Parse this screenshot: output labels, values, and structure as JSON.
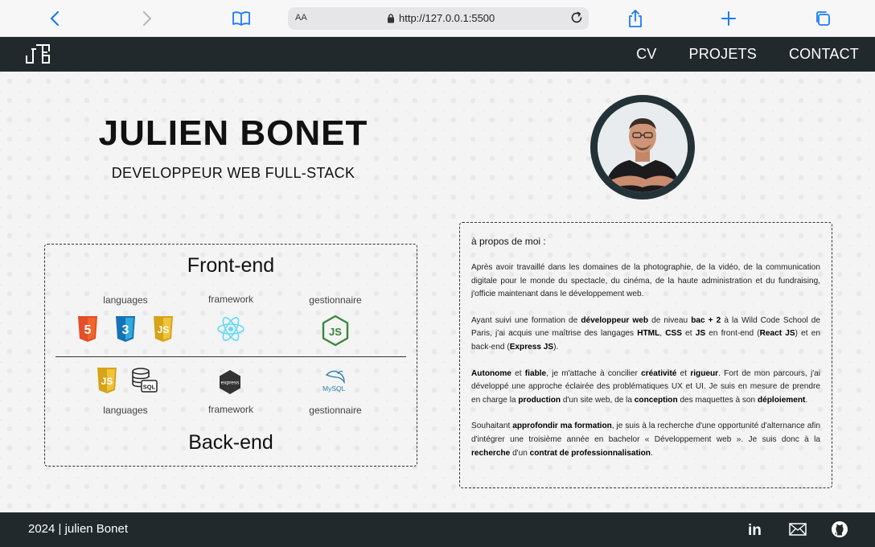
{
  "browser": {
    "url_text_size": "AA",
    "url": "http://127.0.0.1:5500"
  },
  "header": {
    "logo_text": "JB",
    "nav": [
      {
        "label": "CV"
      },
      {
        "label": "PROJETS"
      },
      {
        "label": "CONTACT"
      }
    ]
  },
  "hero": {
    "name": "JULIEN BONET",
    "title": "DEVELOPPEUR WEB FULL-STACK"
  },
  "skills": {
    "front_heading": "Front-end",
    "back_heading": "Back-end",
    "front_labels": [
      "languages",
      "framework",
      "gestionnaire"
    ],
    "back_labels": [
      "languages",
      "framework",
      "gestionnaire"
    ],
    "icons": {
      "html5": "5",
      "css3": "3",
      "js": "JS",
      "nodejs": "JS",
      "sql": "SQL",
      "express": "express",
      "mysql": "MySQL"
    }
  },
  "about": {
    "heading": "à propos de moi :",
    "p1": "Après avoir travaillé dans les domaines de la photographie, de la vidéo, de la communication digitale pour le monde du spectacle, du cinéma, de la haute administration et du fundraising, j'officie maintenant dans le développement web.",
    "p2": {
      "t1": "Ayant suivi une formation de ",
      "b1": "développeur web",
      "t2": " de niveau ",
      "b2": "bac + 2",
      "t3": " à la Wild Code School de Paris, j'ai acquis une maîtrise des langages ",
      "b3": "HTML",
      "t4": ", ",
      "b4": "CSS",
      "t5": " et ",
      "b5": "JS",
      "t6": " en front-end (",
      "b6": "React JS",
      "t7": ") et en back-end (",
      "b7": "Express JS",
      "t8": ")."
    },
    "p3": {
      "b1": "Autonome",
      "t1": " et ",
      "b2": "fiable",
      "t2": ", je m'attache à concilier ",
      "b3": "créativité",
      "t3": " et ",
      "b4": "rigueur",
      "t4": ". Fort de mon parcours, j'ai développé une approche éclairée des problématiques UX et UI. Je suis en mesure de prendre en charge la ",
      "b5": "production",
      "t5": " d'un site web, de la ",
      "b6": "conception",
      "t6": " des maquettes à son ",
      "b7": "déploiement",
      "t7": "."
    },
    "p4": {
      "t1": "Souhaitant ",
      "b1": "approfondir ma formation",
      "t2": ", je suis à la recherche d'une opportunité d'alternance afin d'intégrer une troisième année en bachelor « Développement web ». Je suis donc à la ",
      "b2": "recherche",
      "t3": " d'un ",
      "b3": "contrat de professionnalisation",
      "t4": "."
    }
  },
  "footer": {
    "copyright": "2024 | julien Bonet",
    "linkedin": "in"
  },
  "colors": {
    "header_bg": "#22292d",
    "avatar_ring": "#233236"
  }
}
